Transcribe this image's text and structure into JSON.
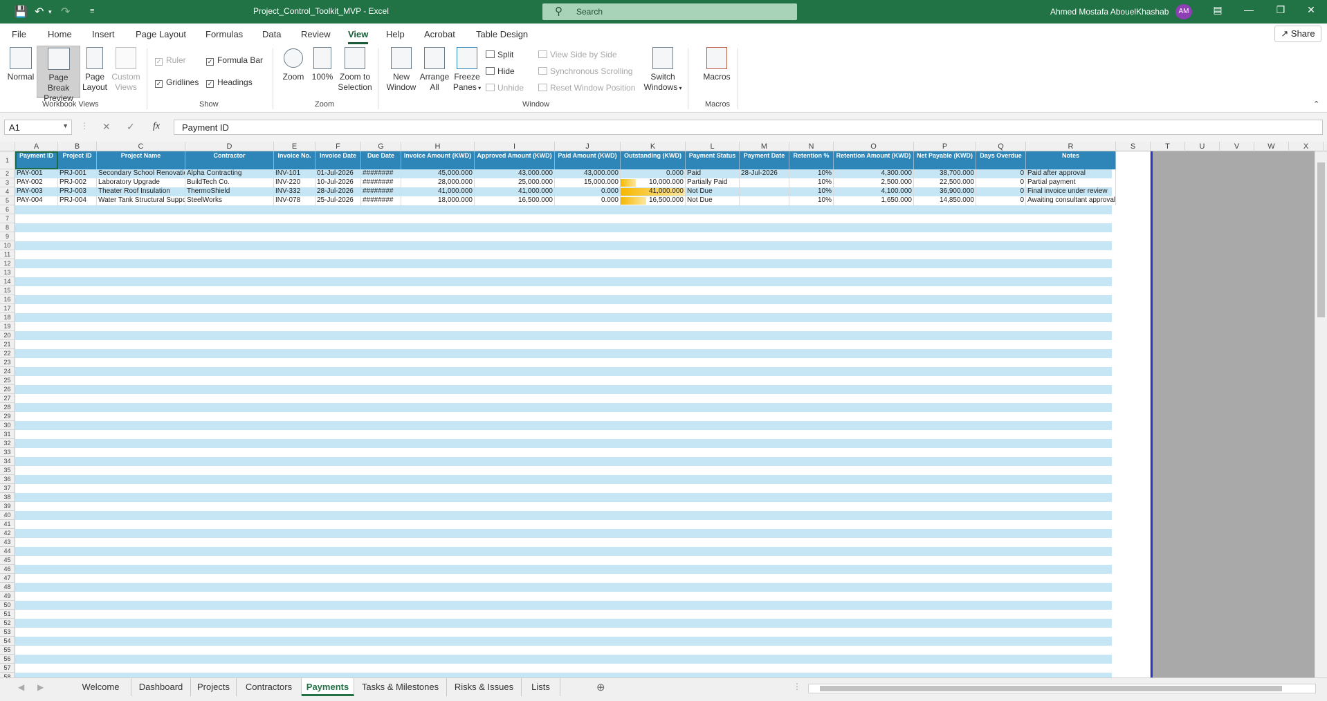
{
  "titlebar": {
    "doc_title": "Project_Control_Toolkit_MVP  -  Excel",
    "search_placeholder": "Search",
    "user_name": "Ahmed Mostafa AbouelKhashab",
    "avatar_initials": "AM",
    "accent": "#217346"
  },
  "ribbon_tabs": [
    "File",
    "Home",
    "Insert",
    "Page Layout",
    "Formulas",
    "Data",
    "Review",
    "View",
    "Help",
    "Acrobat",
    "Table Design"
  ],
  "active_tab": "View",
  "share_label": "Share",
  "ribbon": {
    "workbook_views": {
      "label": "Workbook Views",
      "normal": "Normal",
      "page_break": "Page Break Preview",
      "page_layout": "Page Layout",
      "custom_views": "Custom Views"
    },
    "show": {
      "label": "Show",
      "ruler": "Ruler",
      "formula_bar": "Formula Bar",
      "gridlines": "Gridlines",
      "headings": "Headings"
    },
    "zoom": {
      "label": "Zoom",
      "zoom": "Zoom",
      "hundred": "100%",
      "zoom_selection": "Zoom to Selection"
    },
    "window": {
      "label": "Window",
      "new_window": "New Window",
      "arrange_all": "Arrange All",
      "freeze_panes": "Freeze Panes",
      "split": "Split",
      "hide": "Hide",
      "unhide": "Unhide",
      "side_by_side": "View Side by Side",
      "sync_scroll": "Synchronous Scrolling",
      "reset_pos": "Reset Window Position",
      "switch_windows": "Switch Windows"
    },
    "macros": {
      "label": "Macros",
      "macros": "Macros"
    }
  },
  "formula_bar": {
    "name_box": "A1",
    "fx": "fx",
    "value": "Payment ID"
  },
  "columns": [
    "A",
    "B",
    "C",
    "D",
    "E",
    "F",
    "G",
    "H",
    "I",
    "J",
    "K",
    "L",
    "M",
    "N",
    "O",
    "P",
    "Q",
    "R",
    "S",
    "T",
    "U",
    "V",
    "W",
    "X"
  ],
  "table": {
    "headers": [
      "Payment ID",
      "Project ID",
      "Project Name",
      "Contractor",
      "Invoice No.",
      "Invoice Date",
      "Due Date",
      "Invoice Amount (KWD)",
      "Approved Amount (KWD)",
      "Paid Amount (KWD)",
      "Outstanding (KWD)",
      "Payment Status",
      "Payment Date",
      "Retention %",
      "Retention Amount (KWD)",
      "Net Payable (KWD)",
      "Days Overdue",
      "Notes"
    ],
    "rows": [
      [
        "PAY-001",
        "PRJ-001",
        "Secondary School Renovation",
        "Alpha Contracting",
        "INV-101",
        "01-Jul-2026",
        "########",
        "45,000.000",
        "43,000.000",
        "43,000.000",
        "0.000",
        "Paid",
        "28-Jul-2026",
        "10%",
        "4,300.000",
        "38,700.000",
        "0",
        "Paid after approval"
      ],
      [
        "PAY-002",
        "PRJ-002",
        "Laboratory Upgrade",
        "BuildTech Co.",
        "INV-220",
        "10-Jul-2026",
        "########",
        "28,000.000",
        "25,000.000",
        "15,000.000",
        "10,000.000",
        "Partially Paid",
        "",
        "10%",
        "2,500.000",
        "22,500.000",
        "0",
        "Partial payment"
      ],
      [
        "PAY-003",
        "PRJ-003",
        "Theater Roof Insulation",
        "ThermoShield",
        "INV-332",
        "28-Jul-2026",
        "########",
        "41,000.000",
        "41,000.000",
        "0.000",
        "41,000.000",
        "Not Due",
        "",
        "10%",
        "4,100.000",
        "36,900.000",
        "0",
        "Final invoice under review"
      ],
      [
        "PAY-004",
        "PRJ-004",
        "Water Tank Structural Support",
        "SteelWorks",
        "INV-078",
        "25-Jul-2026",
        "########",
        "18,000.000",
        "16,500.000",
        "0.000",
        "16,500.000",
        "Not Due",
        "",
        "10%",
        "1,650.000",
        "14,850.000",
        "0",
        "Awaiting consultant approval"
      ]
    ],
    "outstanding_fill": [
      0,
      0.24,
      1.0,
      0.4
    ],
    "header_color": "#2e86b8",
    "band_color": "#c7e6f5",
    "bar_color": "#f5b700"
  },
  "sheet_tabs": [
    "Welcome",
    "Dashboard",
    "Projects",
    "Contractors",
    "Payments",
    "Tasks & Milestones",
    "Risks & Issues",
    "Lists"
  ],
  "active_sheet": "Payments"
}
